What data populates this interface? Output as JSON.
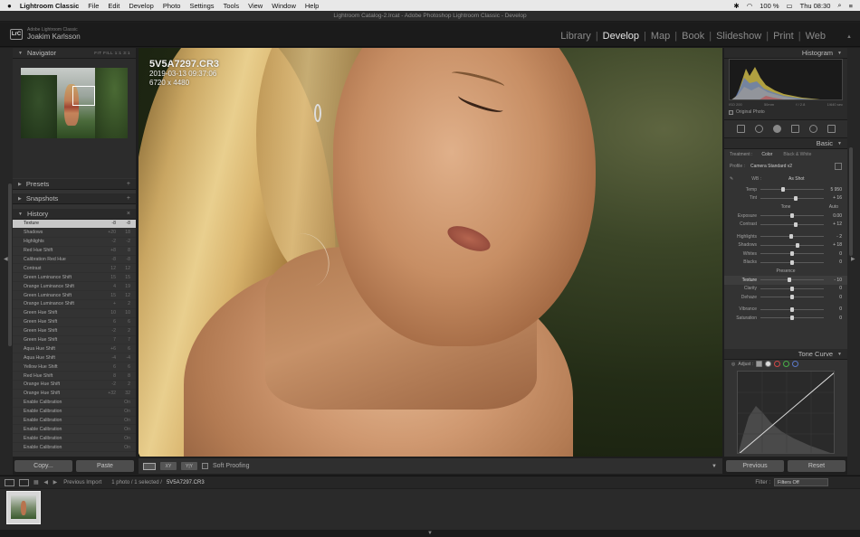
{
  "menubar": {
    "apple": "",
    "app": "Lightroom Classic",
    "items": [
      "File",
      "Edit",
      "Develop",
      "Photo",
      "Settings",
      "Tools",
      "View",
      "Window",
      "Help"
    ],
    "battery": "100 %",
    "clock": "Thu 08:30"
  },
  "window": {
    "title": "Lightroom Catalog-2.lrcat - Adobe Photoshop Lightroom Classic - Develop"
  },
  "identity": {
    "badge": "LrC",
    "product": "Adobe Lightroom Classic",
    "user": "Joakim Karlsson"
  },
  "modules": [
    "Library",
    "Develop",
    "Map",
    "Book",
    "Slideshow",
    "Print",
    "Web"
  ],
  "left": {
    "navigator": {
      "title": "Navigator",
      "zooms": "FIT FILL 1:1 3:1"
    },
    "presets": {
      "title": "Presets"
    },
    "snapshots": {
      "title": "Snapshots"
    },
    "history": {
      "title": "History",
      "items": [
        {
          "label": "Texture",
          "from": "-8",
          "to": "-8"
        },
        {
          "label": "Shadows",
          "from": "+20",
          "to": "18"
        },
        {
          "label": "Highlights",
          "from": "-2",
          "to": "-2"
        },
        {
          "label": "Red Hue Shift",
          "from": "+8",
          "to": "8"
        },
        {
          "label": "Calibration Red Hue",
          "from": "-8",
          "to": "-8"
        },
        {
          "label": "Contrast",
          "from": "12",
          "to": "12"
        },
        {
          "label": "Green Luminance Shift",
          "from": "15",
          "to": "15"
        },
        {
          "label": "Orange Luminance Shift",
          "from": "4",
          "to": "19"
        },
        {
          "label": "Green Luminance Shift",
          "from": "15",
          "to": "12"
        },
        {
          "label": "Orange Luminance Shift",
          "from": "+",
          "to": "2"
        },
        {
          "label": "Green Hue Shift",
          "from": "10",
          "to": "10"
        },
        {
          "label": "Green Hue Shift",
          "from": "6",
          "to": "6"
        },
        {
          "label": "Green Hue Shift",
          "from": "-2",
          "to": "2"
        },
        {
          "label": "Green Hue Shift",
          "from": "7",
          "to": "7"
        },
        {
          "label": "Aqua Hue Shift",
          "from": "+6",
          "to": "6"
        },
        {
          "label": "Aqua Hue Shift",
          "from": "-4",
          "to": "-4"
        },
        {
          "label": "Yellow Hue Shift",
          "from": "6",
          "to": "6"
        },
        {
          "label": "Red Hue Shift",
          "from": "8",
          "to": "8"
        },
        {
          "label": "Orange Hue Shift",
          "from": "-2",
          "to": "2"
        },
        {
          "label": "Orange Hue Shift",
          "from": "+32",
          "to": "32"
        },
        {
          "label": "Enable Calibration",
          "from": "",
          "to": "On"
        },
        {
          "label": "Enable Calibration",
          "from": "",
          "to": "On"
        },
        {
          "label": "Enable Calibration",
          "from": "",
          "to": "On"
        },
        {
          "label": "Enable Calibration",
          "from": "",
          "to": "On"
        },
        {
          "label": "Enable Calibration",
          "from": "",
          "to": "On"
        },
        {
          "label": "Enable Calibration",
          "from": "",
          "to": "On"
        }
      ]
    },
    "copy_label": "Copy...",
    "paste_label": "Paste"
  },
  "photo": {
    "filename": "5V5A7297.CR3",
    "datetime": "2019-03-13 09:37:06",
    "dimensions": "6720 x 4480"
  },
  "toolbar": {
    "view1": "",
    "view2": "XY",
    "view3": "Y|Y",
    "soft_proofing": "Soft Proofing"
  },
  "right": {
    "histogram": {
      "title": "Histogram",
      "iso": "ISO 200",
      "focal": "50mm",
      "aperture": "f / 2.8",
      "shutter": "1/640 sec",
      "original_photo": "Original Photo"
    },
    "basic": {
      "title": "Basic",
      "treatment_label": "Treatment :",
      "treatment_color": "Color",
      "treatment_bw": "Black & White",
      "profile_label": "Profile :",
      "profile_value": "Camera Standard v2",
      "wb_label": "WB :",
      "wb_value": "As Shot",
      "tone_label": "Tone",
      "tone_auto": "Auto",
      "presence_label": "Presence",
      "sliders": [
        {
          "label": "Temp",
          "value": "5 950",
          "pos": 0.35,
          "active": false
        },
        {
          "label": "Tint",
          "value": "+ 16",
          "pos": 0.55,
          "active": false
        },
        {
          "label": "Exposure",
          "value": "0.00",
          "pos": 0.5,
          "active": false
        },
        {
          "label": "Contrast",
          "value": "+ 12",
          "pos": 0.55,
          "active": false
        },
        {
          "label": "Highlights",
          "value": "- 2",
          "pos": 0.49,
          "active": false
        },
        {
          "label": "Shadows",
          "value": "+ 18",
          "pos": 0.58,
          "active": false
        },
        {
          "label": "Whites",
          "value": "0",
          "pos": 0.5,
          "active": false
        },
        {
          "label": "Blacks",
          "value": "0",
          "pos": 0.5,
          "active": false
        },
        {
          "label": "Texture",
          "value": "- 10",
          "pos": 0.45,
          "active": true
        },
        {
          "label": "Clarity",
          "value": "0",
          "pos": 0.5,
          "active": false
        },
        {
          "label": "Dehaze",
          "value": "0",
          "pos": 0.5,
          "active": false
        },
        {
          "label": "Vibrance",
          "value": "0",
          "pos": 0.5,
          "active": false
        },
        {
          "label": "Saturation",
          "value": "0",
          "pos": 0.5,
          "active": false
        }
      ]
    },
    "tonecurve": {
      "title": "Tone Curve",
      "adjust_label": "Adjust :"
    },
    "previous_label": "Previous",
    "reset_label": "Reset"
  },
  "filmbar": {
    "source": "Previous Import",
    "count": "1 photo / 1 selected /",
    "selected_file": "5V5A7297.CR3",
    "filter_label": "Filter :",
    "filter_value": "Filters Off"
  },
  "colors": {
    "panel": "#333333",
    "header": "#2a2a2a",
    "accent": "#e6e6e6"
  }
}
